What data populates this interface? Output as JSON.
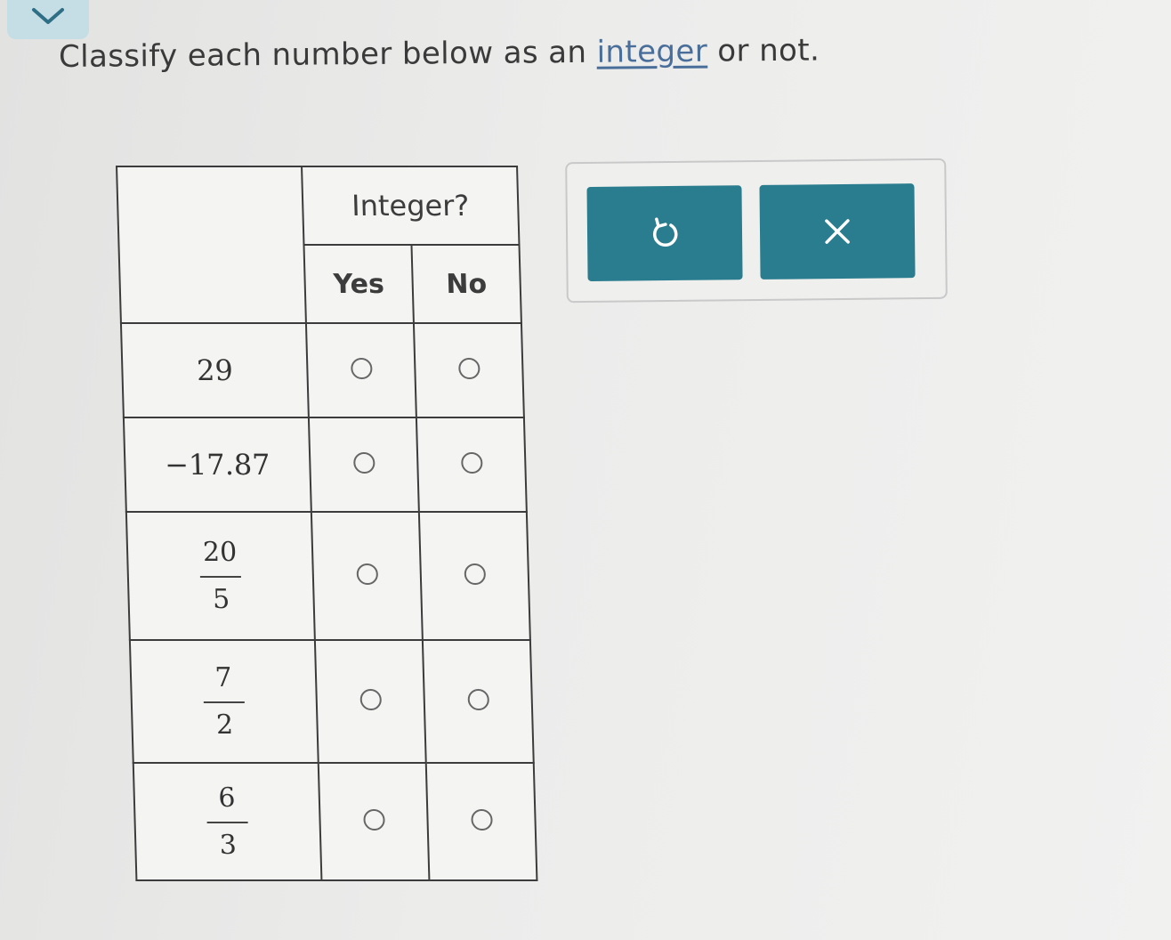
{
  "prompt": {
    "before": "Classify each number below as an ",
    "link": "integer",
    "after": " or not."
  },
  "table": {
    "group_header": "Integer?",
    "columns": [
      "Yes",
      "No"
    ],
    "rows": [
      {
        "type": "plain",
        "value": "29"
      },
      {
        "type": "plain",
        "value": "−17.87"
      },
      {
        "type": "fraction",
        "numerator": "20",
        "denominator": "5"
      },
      {
        "type": "fraction",
        "numerator": "7",
        "denominator": "2"
      },
      {
        "type": "fraction",
        "numerator": "6",
        "denominator": "3"
      }
    ]
  },
  "toolbar": {
    "undo_icon": "undo-icon",
    "clear_icon": "close-icon"
  },
  "colors": {
    "button": "#2a7d8e",
    "link": "#4a6e9a",
    "tab": "#c5dde5"
  }
}
